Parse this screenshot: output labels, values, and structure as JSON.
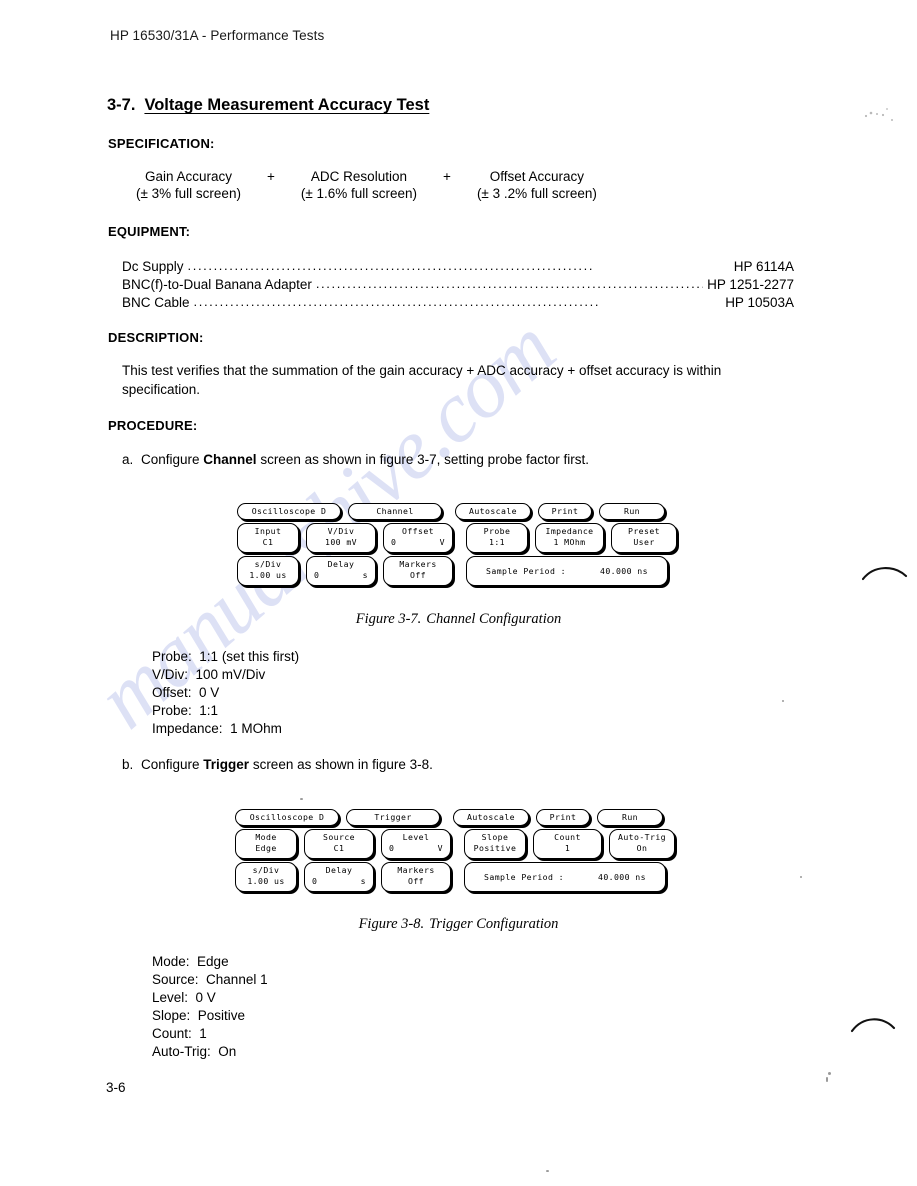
{
  "page": {
    "running_head": "HP 16530/31A - Performance Tests",
    "folio": "3-6",
    "watermark": "manualshive.com",
    "watermark_color": "#c9cff0"
  },
  "section": {
    "number": "3-7.",
    "title": "Voltage Measurement Accuracy Test"
  },
  "headings": {
    "specification": "SPECIFICATION:",
    "equipment": "EQUIPMENT:",
    "description": "DESCRIPTION:",
    "procedure": "PROCEDURE:"
  },
  "specification": {
    "terms": [
      {
        "label": "Gain Accuracy",
        "tolerance": "(± 3% full screen)"
      },
      {
        "label": "ADC Resolution",
        "tolerance": "(± 1.6% full screen)"
      },
      {
        "label": "Offset Accuracy",
        "tolerance": "(± 3 .2% full screen)"
      }
    ],
    "operator": "+"
  },
  "equipment": {
    "items": [
      {
        "name": "Dc Supply",
        "part": "HP 6114A"
      },
      {
        "name": "BNC(f)-to-Dual Banana Adapter",
        "part": "HP 1251-2277"
      },
      {
        "name": "BNC Cable",
        "part": "HP 10503A"
      }
    ]
  },
  "description": {
    "text": "This test verifies that the summation of the gain accuracy + ADC accuracy + offset accuracy is within specification."
  },
  "procedure": {
    "steps": [
      {
        "letter": "a.",
        "text_before": "Configure ",
        "bold": "Channel",
        "text_after": " screen as shown in figure 3-7, setting probe factor first."
      },
      {
        "letter": "b.",
        "text_before": "Configure ",
        "bold": "Trigger",
        "text_after": " screen as shown in figure 3-8."
      }
    ]
  },
  "figures": [
    {
      "id": "3-7",
      "caption_number": "Figure 3-7.",
      "caption_title": "Channel Configuration",
      "row1": [
        {
          "name": "machine-selector",
          "l1": "Oscilloscope D"
        },
        {
          "name": "menu-selector",
          "l1": "Channel"
        },
        {
          "name": "autoscale",
          "l1": "Autoscale"
        },
        {
          "name": "print",
          "l1": "Print"
        },
        {
          "name": "run",
          "l1": "Run"
        }
      ],
      "row2": [
        {
          "name": "input",
          "l1": "Input",
          "l2": "C1"
        },
        {
          "name": "v-div",
          "l1": "V/Div",
          "l2": "100 mV"
        },
        {
          "name": "offset",
          "l1": "Offset",
          "l2_left": "0",
          "l2_right": "V"
        },
        {
          "name": "probe",
          "l1": "Probe",
          "l2": "1:1"
        },
        {
          "name": "impedance",
          "l1": "Impedance",
          "l2": "1 MOhm"
        },
        {
          "name": "preset",
          "l1": "Preset",
          "l2": "User"
        }
      ],
      "row3": [
        {
          "name": "s-div",
          "l1": "s/Div",
          "l2": "1.00 us"
        },
        {
          "name": "delay",
          "l1": "Delay",
          "l2_left": "0",
          "l2_right": "s"
        },
        {
          "name": "markers",
          "l1": "Markers",
          "l2": "Off"
        }
      ],
      "sample_period": {
        "label": "Sample Period :",
        "value": "40.000 ns"
      },
      "settings": [
        {
          "label": "Probe:",
          "value": "1:1  (set this first)"
        },
        {
          "label": "V/Div:",
          "value": "100 mV/Div"
        },
        {
          "label": "Offset:",
          "value": "0 V"
        },
        {
          "label": "Probe:",
          "value": "1:1"
        },
        {
          "label": "Impedance:",
          "value": "1 MOhm"
        }
      ]
    },
    {
      "id": "3-8",
      "caption_number": "Figure 3-8.",
      "caption_title": "Trigger Configuration",
      "row1": [
        {
          "name": "machine-selector",
          "l1": "Oscilloscope D"
        },
        {
          "name": "menu-selector",
          "l1": "Trigger"
        },
        {
          "name": "autoscale",
          "l1": "Autoscale"
        },
        {
          "name": "print",
          "l1": "Print"
        },
        {
          "name": "run",
          "l1": "Run"
        }
      ],
      "row2": [
        {
          "name": "mode",
          "l1": "Mode",
          "l2": "Edge"
        },
        {
          "name": "source",
          "l1": "Source",
          "l2": "C1"
        },
        {
          "name": "level",
          "l1": "Level",
          "l2_left": "0",
          "l2_right": "V"
        },
        {
          "name": "slope",
          "l1": "Slope",
          "l2": "Positive"
        },
        {
          "name": "count",
          "l1": "Count",
          "l2": "1"
        },
        {
          "name": "auto-trig",
          "l1": "Auto-Trig",
          "l2": "On"
        }
      ],
      "row3": [
        {
          "name": "s-div",
          "l1": "s/Div",
          "l2": "1.00 us"
        },
        {
          "name": "delay",
          "l1": "Delay",
          "l2_left": "0",
          "l2_right": "s"
        },
        {
          "name": "markers",
          "l1": "Markers",
          "l2": "Off"
        }
      ],
      "sample_period": {
        "label": "Sample Period :",
        "value": "40.000 ns"
      },
      "settings": [
        {
          "label": "Mode:",
          "value": "Edge"
        },
        {
          "label": "Source:",
          "value": "Channel 1"
        },
        {
          "label": "Level:",
          "value": "0 V"
        },
        {
          "label": "Slope:",
          "value": "Positive"
        },
        {
          "label": "Count:",
          "value": "1"
        },
        {
          "label": "Auto-Trig:",
          "value": "On"
        }
      ]
    }
  ]
}
